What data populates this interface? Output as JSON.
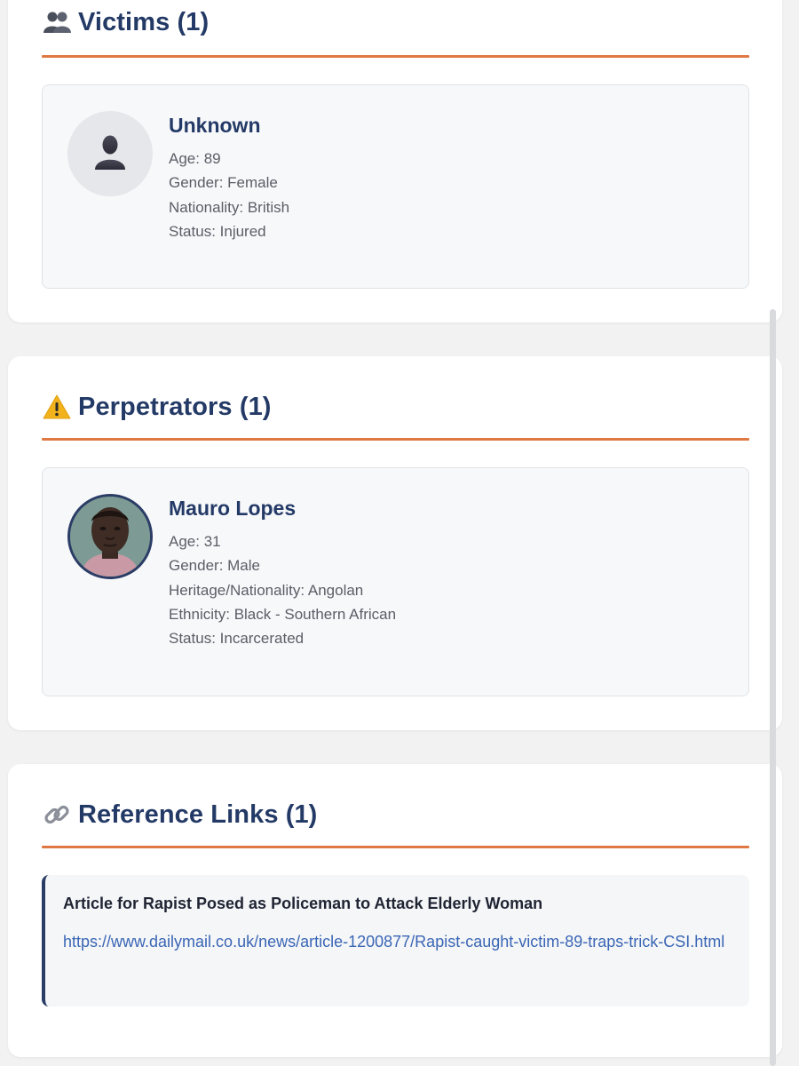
{
  "victims": {
    "title": "Victims (1)",
    "icon": "people-icon",
    "people": [
      {
        "name": "Unknown",
        "avatar": "person-silhouette-icon",
        "lines": [
          "Age: 89",
          "Gender: Female",
          "Nationality: British",
          "Status: Injured"
        ]
      }
    ]
  },
  "perpetrators": {
    "title": "Perpetrators (1)",
    "icon": "warning-icon",
    "people": [
      {
        "name": "Mauro Lopes",
        "avatar": "person-photo",
        "lines": [
          "Age: 31",
          "Gender: Male",
          "Heritage/Nationality: Angolan",
          "Ethnicity: Black - Southern African",
          "Status: Incarcerated"
        ]
      }
    ]
  },
  "references": {
    "title": "Reference Links (1)",
    "icon": "link-icon",
    "links": [
      {
        "title": "Article for Rapist Posed as Policeman to Attack Elderly Woman",
        "url": "https://www.dailymail.co.uk/news/article-1200877/Rapist-caught-victim-89-traps-trick-CSI.html"
      }
    ]
  },
  "colors": {
    "heading": "#243a66",
    "accent_rule": "#e07843",
    "link": "#3a66b5",
    "card": "#ffffff",
    "background": "#f2f2f2"
  }
}
